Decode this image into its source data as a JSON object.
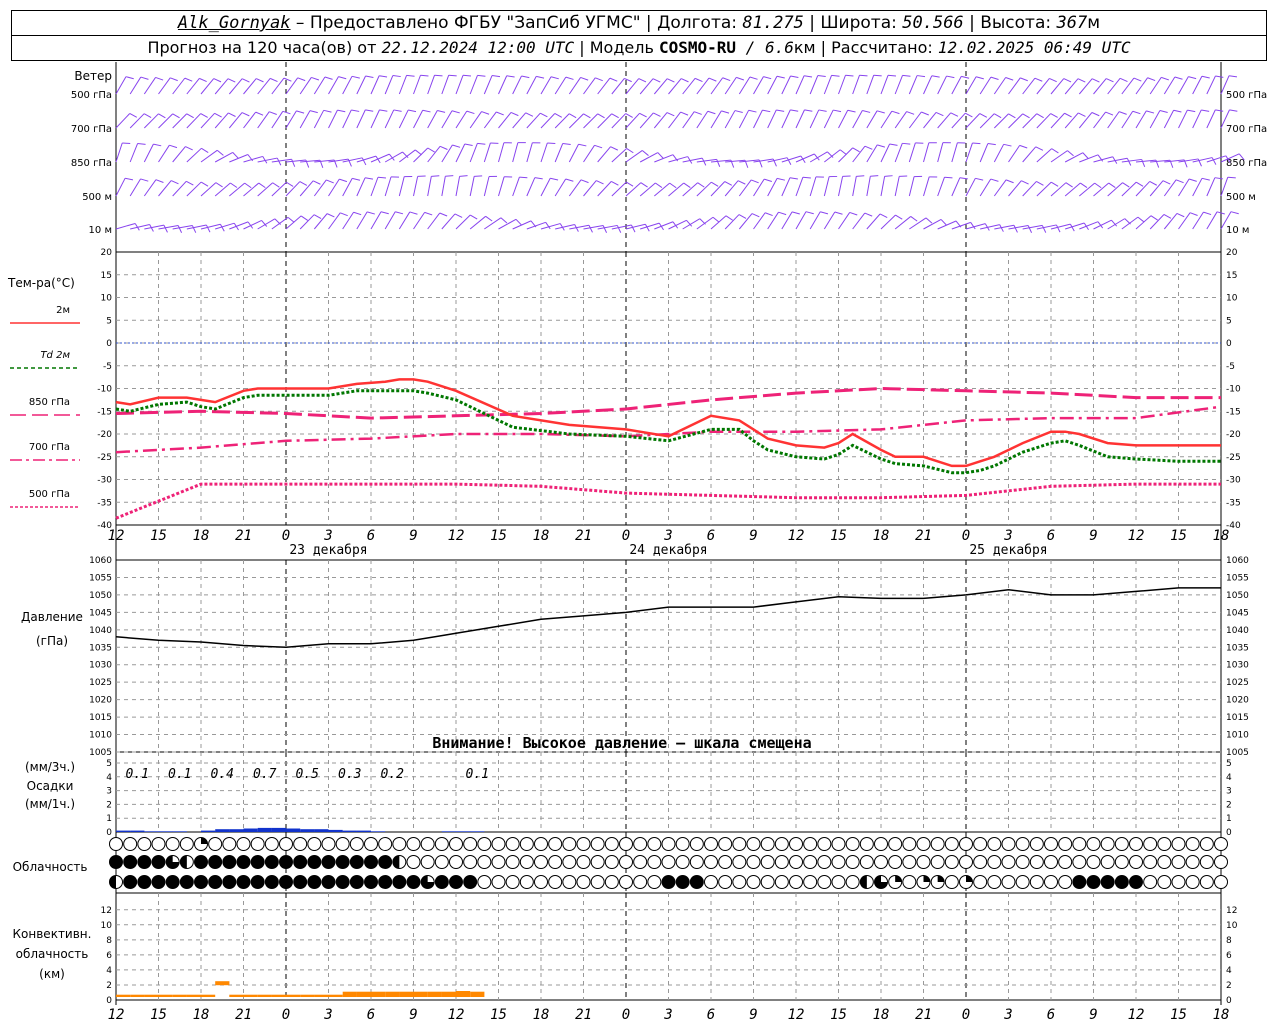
{
  "header": {
    "station": "Alk_Gornyak",
    "dash": " – ",
    "provider": "Предоставлено ФГБУ \"ЗапСиб УГМС\"",
    "sep": " | ",
    "lon_label": "Долгота: ",
    "lon_value": "81.275",
    "lat_label": "Широта: ",
    "lat_value": "50.566",
    "alt_label": "Высота: ",
    "alt_value": "367",
    "alt_unit": "м",
    "forecast_label": "Прогноз на 120 часа(ов) от ",
    "forecast_start": "22.12.2024 12:00 UTC",
    "model_label": " | Модель ",
    "model_name": "COSMO-RU",
    "model_res_sep": " / ",
    "model_res": "6.6",
    "model_res_unit": "км",
    "calc_label": " | Рассчитано: ",
    "calc_time": "12.02.2025 06:49 UTC"
  },
  "colors": {
    "t2m": "#ff3333",
    "td2m": "#007700",
    "t850": "#ee2277",
    "t700": "#ee2277",
    "t500": "#ee2277",
    "wind": "#8844ee",
    "pressure": "#000000",
    "precip": "#1133cc",
    "convective": "#ff8800",
    "zero_line": "#3355cc",
    "grid": "#999999"
  },
  "time_axis": {
    "hour_labels": [
      "12",
      "15",
      "18",
      "21",
      "0",
      "3",
      "6",
      "9",
      "12",
      "15",
      "18",
      "21",
      "0",
      "3",
      "6",
      "9",
      "12",
      "15",
      "18",
      "21",
      "0",
      "3",
      "6",
      "9",
      "12",
      "15",
      "18"
    ],
    "day_labels": [
      {
        "text": "23 декабря",
        "hour": 15
      },
      {
        "text": "24 декабря",
        "hour": 39
      },
      {
        "text": "25 декабря",
        "hour": 63
      }
    ],
    "midnights": [
      12,
      36,
      60
    ]
  },
  "wind_panel": {
    "title": "Ветер",
    "levels": [
      "500 гПа",
      "700 гПа",
      "850 гПа",
      "500 м",
      "10  м"
    ],
    "right_levels": [
      "500 гПа",
      "700 гПа",
      "850 гПа",
      "500 м",
      "10  м"
    ]
  },
  "temp_panel": {
    "title": "Тем-ра(°C)",
    "legend": [
      {
        "key": "t2m",
        "label": "2м",
        "dash": ""
      },
      {
        "key": "td2m",
        "label": "Td  2м",
        "dash": "4,3"
      },
      {
        "key": "t850",
        "label": "850 гПа",
        "dash": "16,6"
      },
      {
        "key": "t700",
        "label": "700 гПа",
        "dash": "12,4,3,4"
      },
      {
        "key": "t500",
        "label": "500 гПа",
        "dash": "3,2"
      }
    ],
    "ticks": [
      "20",
      "15",
      "10",
      "5",
      "0",
      "-5",
      "-10",
      "-15",
      "-20",
      "-25",
      "-30",
      "-35",
      "-40"
    ]
  },
  "pressure_panel": {
    "title": "Давление",
    "unit": "(гПа)",
    "ticks": [
      "1060",
      "1055",
      "1050",
      "1045",
      "1040",
      "1035",
      "1030",
      "1025",
      "1020",
      "1015",
      "1010",
      "1005"
    ],
    "warning": "Внимание! Высокое давление – шкала смещена"
  },
  "precip_panel": {
    "unit3h": "(мм/3ч.)",
    "title": "Осадки",
    "unit1h": "(мм/1ч.)",
    "ticks": [
      "5",
      "4",
      "3",
      "2",
      "1",
      "0"
    ],
    "totals_3h": [
      {
        "hour": 1.5,
        "text": "0.1"
      },
      {
        "hour": 4.5,
        "text": "0.1"
      },
      {
        "hour": 7.5,
        "text": "0.4"
      },
      {
        "hour": 10.5,
        "text": "0.7"
      },
      {
        "hour": 13.5,
        "text": "0.5"
      },
      {
        "hour": 16.5,
        "text": "0.3"
      },
      {
        "hour": 19.5,
        "text": "0.2"
      },
      {
        "hour": 25.5,
        "text": "0.1"
      }
    ]
  },
  "cloud_panel": {
    "title": "Облачность"
  },
  "conv_panel": {
    "title1": "Конвективн.",
    "title2": "облачность",
    "unit": "(км)",
    "ticks": [
      "12",
      "10",
      "8",
      "6",
      "4",
      "2",
      "0"
    ]
  },
  "chart_data": [
    {
      "type": "line",
      "name": "temperature",
      "x_hours": [
        0,
        1,
        3,
        5,
        6,
        7,
        9,
        10,
        12,
        15,
        17,
        19,
        20,
        21,
        22,
        24,
        28,
        32,
        36,
        39,
        42,
        44,
        45,
        46,
        48,
        50,
        51,
        52,
        54,
        55,
        57,
        59,
        60,
        61,
        62,
        64,
        66,
        67,
        68,
        70,
        72,
        75,
        78
      ],
      "series": [
        {
          "name": "2м",
          "key": "t2m",
          "values": [
            -13,
            -13.5,
            -12,
            -12,
            -12.5,
            -13,
            -10.5,
            -10,
            -10,
            -10,
            -9,
            -8.5,
            -8,
            -8,
            -8.5,
            -10.5,
            -16,
            -18,
            -19,
            -20.5,
            -16,
            -17,
            -19,
            -21,
            -22.5,
            -23,
            -22,
            -20,
            -23.5,
            -25,
            -25,
            -27,
            -27,
            -26,
            -25,
            -22,
            -19.5,
            -19.5,
            -20,
            -22,
            -22.5,
            -22.5,
            -22.5
          ]
        },
        {
          "name": "Td 2м",
          "key": "td2m",
          "values": [
            -14.5,
            -15,
            -13.5,
            -13,
            -14,
            -14.5,
            -12,
            -11.5,
            -11.5,
            -11.5,
            -10.5,
            -10.5,
            -10.5,
            -10.5,
            -11,
            -12.5,
            -18.5,
            -20,
            -20.5,
            -21.5,
            -19,
            -19,
            -21.5,
            -23.5,
            -25,
            -25.5,
            -24.5,
            -22.5,
            -25.5,
            -26.5,
            -27,
            -28.5,
            -28.5,
            -28,
            -27,
            -24,
            -22,
            -21.5,
            -22.5,
            -25,
            -25.5,
            -26,
            -26
          ]
        }
      ],
      "ylim": [
        -40,
        20
      ]
    },
    {
      "type": "line",
      "name": "upper_temperature",
      "x_hours": [
        0,
        6,
        12,
        18,
        24,
        30,
        36,
        42,
        48,
        54,
        60,
        66,
        72,
        78
      ],
      "series": [
        {
          "name": "850 гПа",
          "key": "t850",
          "values": [
            -15.5,
            -15,
            -15.5,
            -16.5,
            -16,
            -15.5,
            -14.5,
            -12.5,
            -11,
            -10,
            -10.5,
            -11,
            -12,
            -12
          ]
        },
        {
          "name": "700 гПа",
          "key": "t700",
          "values": [
            -24,
            -23,
            -21.5,
            -21,
            -20,
            -20,
            -20.5,
            -19.5,
            -19.5,
            -19,
            -17,
            -16.5,
            -16.5,
            -14
          ]
        },
        {
          "name": "500 гПа",
          "key": "t500",
          "values": [
            -38.5,
            -31,
            -31,
            -31,
            -31,
            -31.5,
            -33,
            -33.5,
            -34,
            -34,
            -33.5,
            -31.5,
            -31,
            -31
          ]
        }
      ],
      "ylim": [
        -40,
        20
      ]
    },
    {
      "type": "line",
      "name": "pressure",
      "x_hours": [
        0,
        3,
        6,
        9,
        12,
        15,
        18,
        21,
        24,
        27,
        30,
        33,
        36,
        39,
        42,
        45,
        48,
        51,
        54,
        57,
        60,
        63,
        66,
        69,
        72,
        75,
        78
      ],
      "values": [
        1038,
        1037,
        1036.5,
        1035.5,
        1035,
        1036,
        1036,
        1037,
        1039,
        1041,
        1043,
        1044,
        1045,
        1046.5,
        1046.5,
        1046.5,
        1048,
        1049.5,
        1049,
        1049,
        1050,
        1051.5,
        1050,
        1050,
        1051,
        1052,
        1052
      ],
      "ylim": [
        1005,
        1060
      ],
      "ylabel": "(гПа)"
    },
    {
      "type": "bar",
      "name": "precipitation_1h",
      "x_hours": [
        1,
        2,
        3,
        4,
        5,
        6,
        7,
        8,
        9,
        10,
        11,
        12,
        13,
        14,
        15,
        16,
        17,
        18,
        19,
        20,
        21,
        22,
        23,
        24,
        25,
        26
      ],
      "values": [
        0.1,
        0.1,
        0.05,
        0.05,
        0.05,
        0,
        0.1,
        0.2,
        0.2,
        0.25,
        0.3,
        0.3,
        0.25,
        0.2,
        0.2,
        0.15,
        0.1,
        0.1,
        0.05,
        0,
        0,
        0,
        0,
        0.05,
        0.05,
        0.05
      ],
      "ylim": [
        0,
        5
      ]
    },
    {
      "type": "table",
      "name": "cloudiness",
      "rows": [
        {
          "name": "upper",
          "values": [
            0,
            0,
            0,
            0,
            0,
            0,
            1,
            0,
            0,
            0,
            0,
            0,
            0,
            0,
            0,
            0,
            0,
            0,
            0,
            0,
            0,
            0,
            0,
            0,
            0,
            0,
            0,
            0,
            0,
            0,
            0,
            0,
            0,
            0,
            0,
            0,
            0,
            0,
            0,
            0,
            0,
            0,
            0,
            0,
            0,
            0,
            0,
            0,
            0,
            0,
            0,
            0,
            0,
            0,
            0,
            0,
            0,
            0,
            0,
            0,
            0,
            0,
            0,
            0,
            0,
            0,
            0,
            0,
            0,
            0,
            0,
            0,
            0,
            0,
            0,
            0,
            0,
            0,
            0
          ]
        },
        {
          "name": "middle",
          "values": [
            4,
            4,
            4,
            4,
            3,
            2,
            4,
            4,
            4,
            4,
            4,
            4,
            4,
            4,
            4,
            4,
            4,
            4,
            4,
            4,
            2,
            0,
            0,
            0,
            0,
            0,
            0,
            0,
            0,
            0,
            0,
            0,
            0,
            0,
            0,
            0,
            0,
            0,
            0,
            0,
            0,
            0,
            0,
            0,
            0,
            0,
            0,
            0,
            0,
            0,
            0,
            0,
            0,
            0,
            0,
            0,
            0,
            0,
            0,
            0,
            0,
            0,
            0,
            0,
            0,
            0,
            0,
            0,
            0,
            0,
            0,
            0,
            0,
            0,
            0,
            0,
            0,
            0,
            0
          ]
        },
        {
          "name": "lower",
          "values": [
            2,
            4,
            4,
            4,
            4,
            4,
            4,
            4,
            4,
            4,
            4,
            4,
            4,
            4,
            4,
            4,
            4,
            4,
            4,
            4,
            4,
            4,
            3,
            4,
            4,
            4,
            0,
            0,
            0,
            0,
            0,
            0,
            0,
            0,
            0,
            0,
            0,
            0,
            0,
            4,
            4,
            4,
            0,
            0,
            0,
            0,
            0,
            0,
            0,
            0,
            0,
            0,
            0,
            2,
            3,
            1,
            0,
            1,
            1,
            0,
            1,
            0,
            0,
            0,
            0,
            0,
            0,
            0,
            4,
            4,
            4,
            4,
            4,
            0,
            0,
            0,
            0,
            0,
            0
          ]
        }
      ]
    },
    {
      "type": "bar",
      "name": "convective_cloud_top",
      "x_hours": [
        0,
        1,
        2,
        3,
        4,
        5,
        6,
        7,
        8,
        9,
        10,
        11,
        12,
        13,
        14,
        15,
        16,
        17,
        18,
        19,
        20,
        21,
        22,
        23,
        24,
        25
      ],
      "values": [
        0.7,
        0.7,
        0.7,
        0.7,
        0.7,
        0.7,
        0.7,
        2.5,
        0.7,
        0.7,
        0.7,
        0.7,
        0.7,
        0.7,
        0.7,
        0.7,
        1.1,
        1.1,
        1.1,
        1.1,
        1.1,
        1.1,
        1.1,
        1.1,
        1.2,
        1.1
      ],
      "ylim": [
        0,
        13
      ]
    }
  ]
}
